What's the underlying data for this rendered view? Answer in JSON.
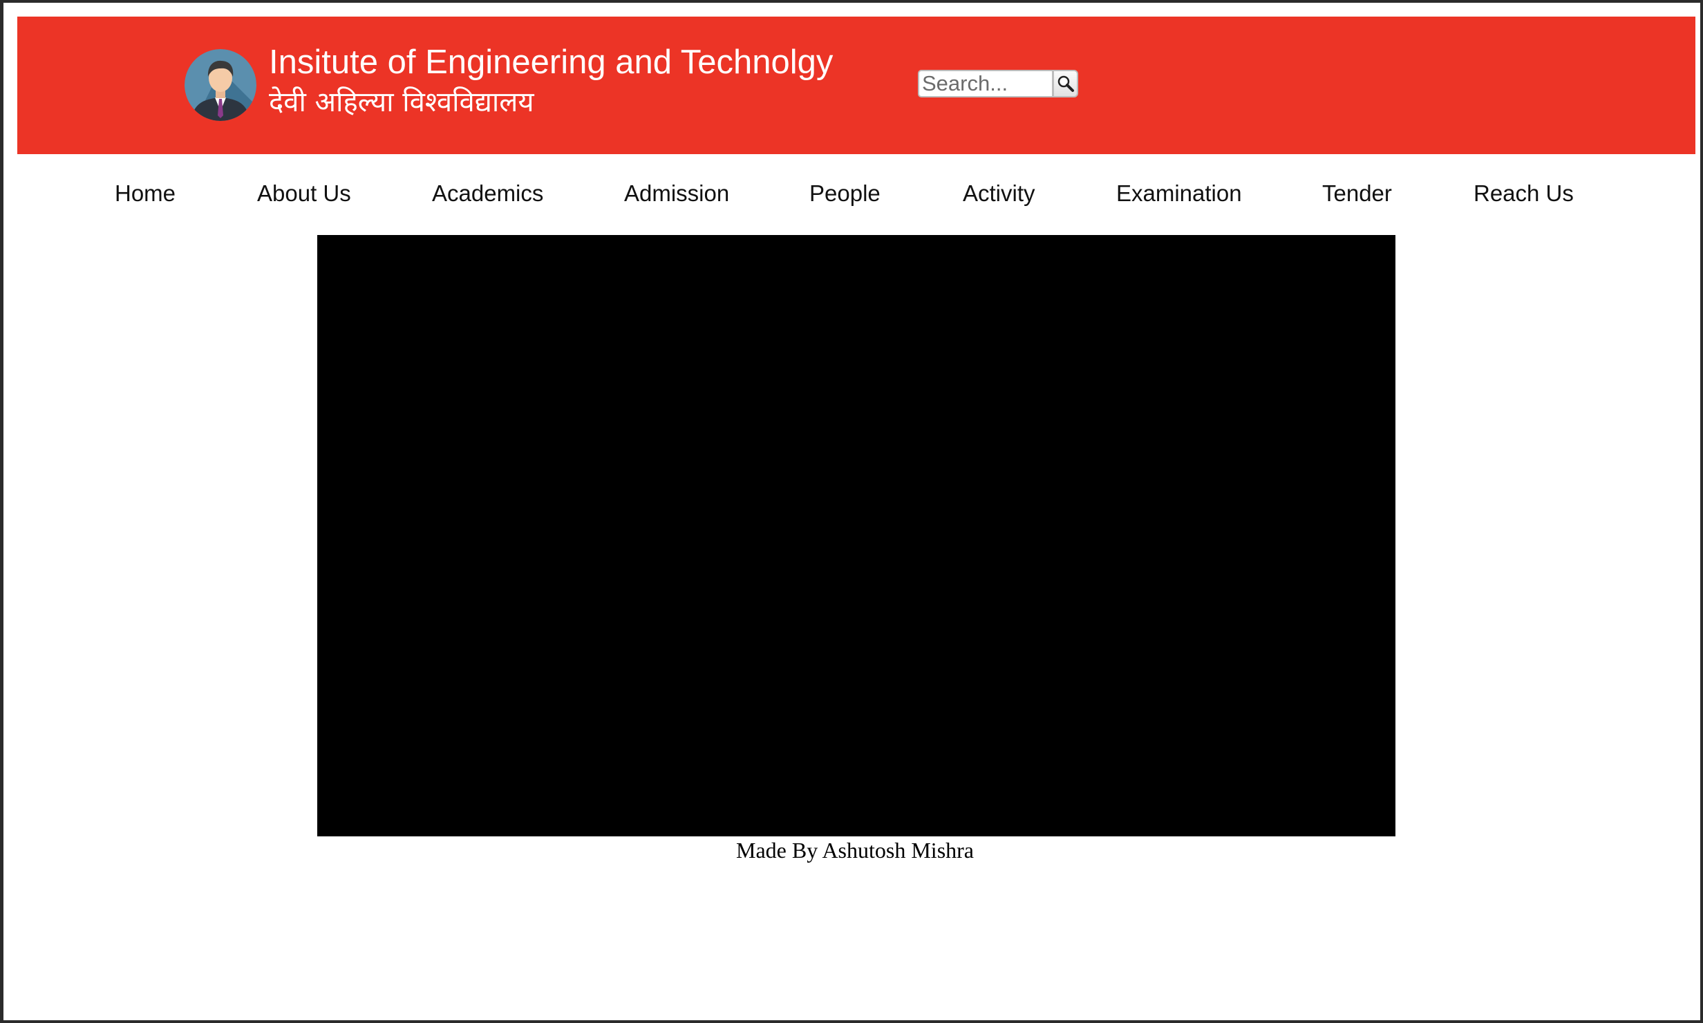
{
  "header": {
    "title": "Insitute of Engineering and Technolgy",
    "subtitle": "देवी अहिल्या विश्वविद्यालय",
    "background_color": "#ec3426",
    "avatar_icon": "person-avatar-icon"
  },
  "search": {
    "placeholder": "Search...",
    "value": "",
    "button_icon": "search-icon"
  },
  "nav": {
    "items": [
      {
        "label": "Home"
      },
      {
        "label": "About Us"
      },
      {
        "label": "Academics"
      },
      {
        "label": "Admission"
      },
      {
        "label": "People"
      },
      {
        "label": "Activity"
      },
      {
        "label": "Examination"
      },
      {
        "label": "Tender"
      },
      {
        "label": "Reach Us"
      }
    ]
  },
  "main": {
    "video_background": "#000000"
  },
  "footer": {
    "credit": "Made By Ashutosh Mishra"
  }
}
